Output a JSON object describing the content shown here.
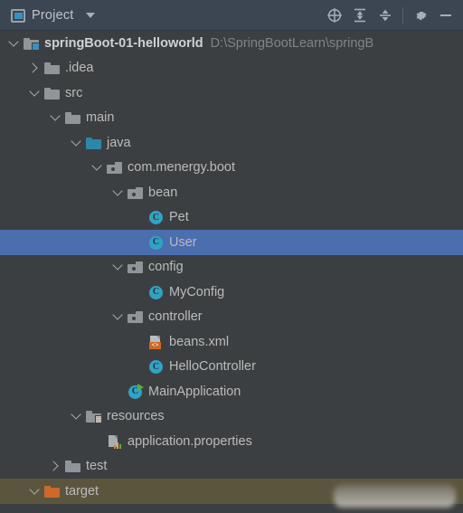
{
  "header": {
    "tool_window_icon": "project-window-icon",
    "title": "Project",
    "dropdown_icon": "chevron-down-icon",
    "actions": [
      {
        "name": "select-opened-file-icon",
        "tooltip": "Select Opened File"
      },
      {
        "name": "expand-all-icon",
        "tooltip": "Expand All"
      },
      {
        "name": "collapse-all-icon",
        "tooltip": "Collapse All"
      },
      {
        "name": "settings-gear-icon",
        "tooltip": "Settings"
      },
      {
        "name": "hide-icon",
        "tooltip": "Hide"
      }
    ]
  },
  "tree": {
    "nodes": [
      {
        "label": "springBoot-01-helloworld",
        "path": "D:\\SpringBootLearn\\springB",
        "icon": "module-folder-icon",
        "indent": 0,
        "twisty": "expanded",
        "bold": true,
        "selected": false,
        "excluded": false
      },
      {
        "label": ".idea",
        "icon": "folder-icon",
        "indent": 1,
        "twisty": "collapsed",
        "bold": false,
        "selected": false,
        "excluded": false
      },
      {
        "label": "src",
        "icon": "folder-icon",
        "indent": 1,
        "twisty": "expanded",
        "bold": false,
        "selected": false,
        "excluded": false
      },
      {
        "label": "main",
        "icon": "folder-icon",
        "indent": 2,
        "twisty": "expanded",
        "bold": false,
        "selected": false,
        "excluded": false
      },
      {
        "label": "java",
        "icon": "source-root-folder-icon",
        "indent": 3,
        "twisty": "expanded",
        "bold": false,
        "selected": false,
        "excluded": false
      },
      {
        "label": "com.menergy.boot",
        "icon": "package-icon",
        "indent": 4,
        "twisty": "expanded",
        "bold": false,
        "selected": false,
        "excluded": false
      },
      {
        "label": "bean",
        "icon": "package-icon",
        "indent": 5,
        "twisty": "expanded",
        "bold": false,
        "selected": false,
        "excluded": false
      },
      {
        "label": "Pet",
        "icon": "java-class-icon",
        "indent": 6,
        "twisty": "none",
        "bold": false,
        "selected": false,
        "excluded": false
      },
      {
        "label": "User",
        "icon": "java-class-icon",
        "indent": 6,
        "twisty": "none",
        "bold": false,
        "selected": true,
        "excluded": false
      },
      {
        "label": "config",
        "icon": "package-icon",
        "indent": 5,
        "twisty": "expanded",
        "bold": false,
        "selected": false,
        "excluded": false
      },
      {
        "label": "MyConfig",
        "icon": "java-class-icon",
        "indent": 6,
        "twisty": "none",
        "bold": false,
        "selected": false,
        "excluded": false
      },
      {
        "label": "controller",
        "icon": "package-icon",
        "indent": 5,
        "twisty": "expanded",
        "bold": false,
        "selected": false,
        "excluded": false
      },
      {
        "label": "beans.xml",
        "icon": "xml-file-icon",
        "indent": 6,
        "twisty": "none",
        "bold": false,
        "selected": false,
        "excluded": false
      },
      {
        "label": "HelloController",
        "icon": "java-class-icon",
        "indent": 6,
        "twisty": "none",
        "bold": false,
        "selected": false,
        "excluded": false
      },
      {
        "label": "MainApplication",
        "icon": "java-runnable-class-icon",
        "indent": 5,
        "twisty": "none",
        "bold": false,
        "selected": false,
        "excluded": false
      },
      {
        "label": "resources",
        "icon": "resources-folder-icon",
        "indent": 3,
        "twisty": "expanded",
        "bold": false,
        "selected": false,
        "excluded": false
      },
      {
        "label": "application.properties",
        "icon": "properties-file-icon",
        "indent": 4,
        "twisty": "none",
        "bold": false,
        "selected": false,
        "excluded": false
      },
      {
        "label": "test",
        "icon": "folder-icon",
        "indent": 2,
        "twisty": "collapsed",
        "bold": false,
        "selected": false,
        "excluded": false
      },
      {
        "label": "target",
        "icon": "excluded-folder-icon",
        "indent": 1,
        "twisty": "expanded",
        "bold": false,
        "selected": false,
        "excluded": true
      }
    ]
  },
  "colors": {
    "header_background": "#3c4552",
    "tree_background": "#3c3f41",
    "selection_blue": "#4b6eaf",
    "excluded_olive": "#5c553d",
    "text": "#bbbbbb",
    "muted_text": "#7e8488",
    "class_icon_teal": "#31a3c4",
    "source_root_blue": "#2e86ab",
    "excluded_orange": "#cc6a29"
  }
}
